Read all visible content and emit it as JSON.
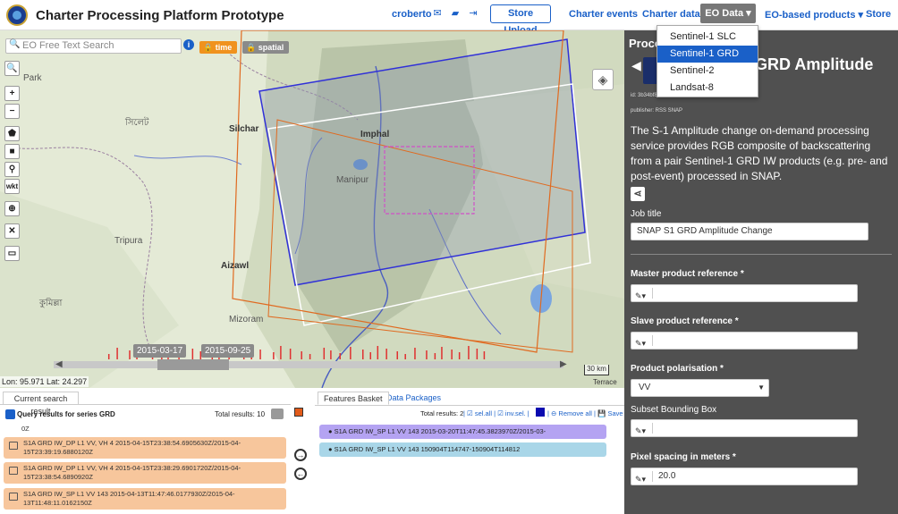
{
  "header": {
    "title": "Charter Processing Platform Prototype",
    "user": "croberto",
    "store_upload": "Store Upload",
    "nav": [
      "Charter events",
      "Charter data",
      "EO Data",
      "EO-based products",
      "Store"
    ],
    "eo_data_dropdown": [
      "Sentinel-1 SLC",
      "Sentinel-1 GRD",
      "Sentinel-2",
      "Landsat-8"
    ],
    "eo_data_selected": "Sentinel-1 GRD"
  },
  "map": {
    "search_placeholder": "EO Free Text Search",
    "filter_time": "time",
    "filter_spatial": "spatial",
    "tools": [
      "zoom-search",
      "zoom-in",
      "zoom-out",
      "polygon",
      "rectangle",
      "marker",
      "wkt",
      "globe",
      "fullscreen",
      "clear"
    ],
    "tool_labels": {
      "zoom_in": "+",
      "zoom_out": "−",
      "wkt": "wkt"
    },
    "labels": {
      "silchar": "Silchar",
      "imphal": "Imphal",
      "manipur": "Manipur",
      "tripura": "Tripura",
      "aizawl": "Aizawl",
      "mizoram": "Mizoram",
      "bengali_1": "সিলেট",
      "bengali_2": "কুমিল্লা",
      "park": "Park"
    },
    "date_start": "2015-03-17",
    "date_end": "2015-09-25",
    "scale": "30 km",
    "coords": "Lon: 95.971 Lat: 24.297",
    "attribution": "Terrace"
  },
  "results": {
    "tab": "Current search result",
    "query_title": "Query results for series GRD",
    "total": "Total results: 10",
    "items": [
      "S1A GRD IW_DP L1 VV, VH 4 2015-04-15T23:38:54.6905630Z/2015-04-15T23:39:19.6880120Z",
      "S1A GRD IW_DP L1 VV, VH 4 2015-04-15T23:38:29.6901720Z/2015-04-15T23:38:54.6890920Z",
      "S1A GRD IW_SP L1 VV 143 2015-04-13T11:47:46.0177930Z/2015-04-13T11:48:11.0162150Z"
    ],
    "partial_item": "0Z"
  },
  "basket": {
    "tab_basket": "Features Basket",
    "tab_packages": "Data Packages",
    "total": "Total results: 2",
    "tools": "| ☑ sel.all | ☑ inv.sel. |",
    "tools_right": "| ⊖ Remove all | 💾 Save",
    "items": [
      {
        "label": "S1A GRD IW_SP L1 VV 143 2015-03-20T11:47:45.3823970Z/2015-03-20T11:48:10.3807270Z",
        "color": "#b4a3f2"
      },
      {
        "label": "S1A GRD IW_SP L1 VV 143 150904T114747-150904T114812",
        "color": "#a9d6e8"
      }
    ]
  },
  "process": {
    "title": "Proce",
    "service_title": "GRD Amplitude",
    "id": "id: 3b34bf8...",
    "publisher": "publisher: RSS SNAP",
    "description": "The S-1 Amplitude change on-demand processing service provides RGB composite of backscattering from a pair Sentinel-1 GRD IW products (e.g. pre- and post-event) processed in SNAP.",
    "job_title_label": "Job title",
    "job_title_value": "SNAP S1 GRD Amplitude Change",
    "master_label": "Master product reference *",
    "slave_label": "Slave product reference *",
    "polarisation_label": "Product polarisation *",
    "polarisation_value": "VV",
    "subset_label": "Subset Bounding Box",
    "pixel_label": "Pixel spacing in meters *",
    "pixel_value": "20.0"
  }
}
